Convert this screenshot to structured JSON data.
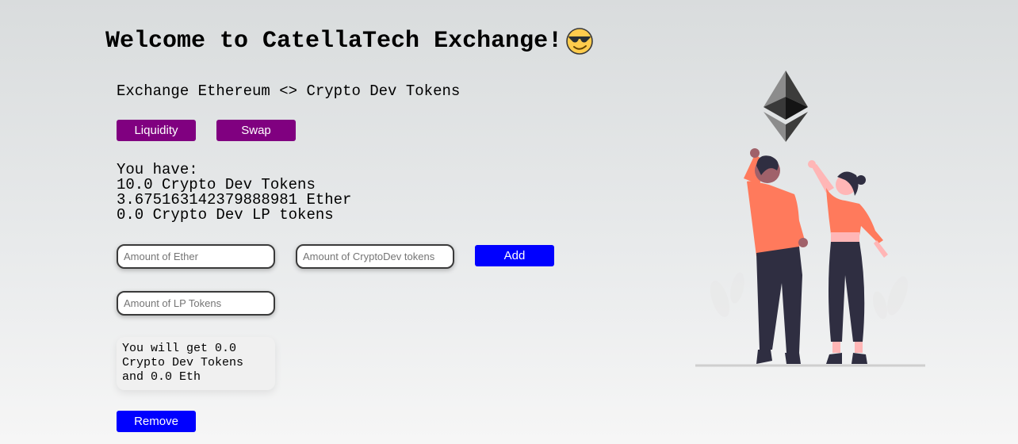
{
  "header": {
    "title": "Welcome to CatellaTech Exchange!",
    "emoji_icon": "sunglasses-face-icon"
  },
  "description": "Exchange Ethereum <> Crypto Dev Tokens",
  "tabs": {
    "liquidity_label": "Liquidity",
    "swap_label": "Swap"
  },
  "balances": {
    "heading": "You have:",
    "crypto_dev_tokens": "10.0 Crypto Dev Tokens",
    "ether": "3.675163142379888981 Ether",
    "lp_tokens": "0.0 Crypto Dev LP tokens"
  },
  "add_liquidity": {
    "ether_placeholder": "Amount of Ether",
    "cryptodev_placeholder": "Amount of CryptoDev tokens",
    "add_label": "Add"
  },
  "remove_liquidity": {
    "lp_placeholder": "Amount of LP Tokens",
    "result_text": "You will get 0.0 Crypto Dev Tokens and 0.0 Eth",
    "remove_label": "Remove"
  },
  "illustration": {
    "icon": "ethereum-logo-icon",
    "scene": "two-people-pointing-illustration"
  },
  "colors": {
    "purple_button": "#800080",
    "blue_button": "#0000ff",
    "accent_orange": "#ff7a5c",
    "dark_navy": "#2f2e41"
  }
}
